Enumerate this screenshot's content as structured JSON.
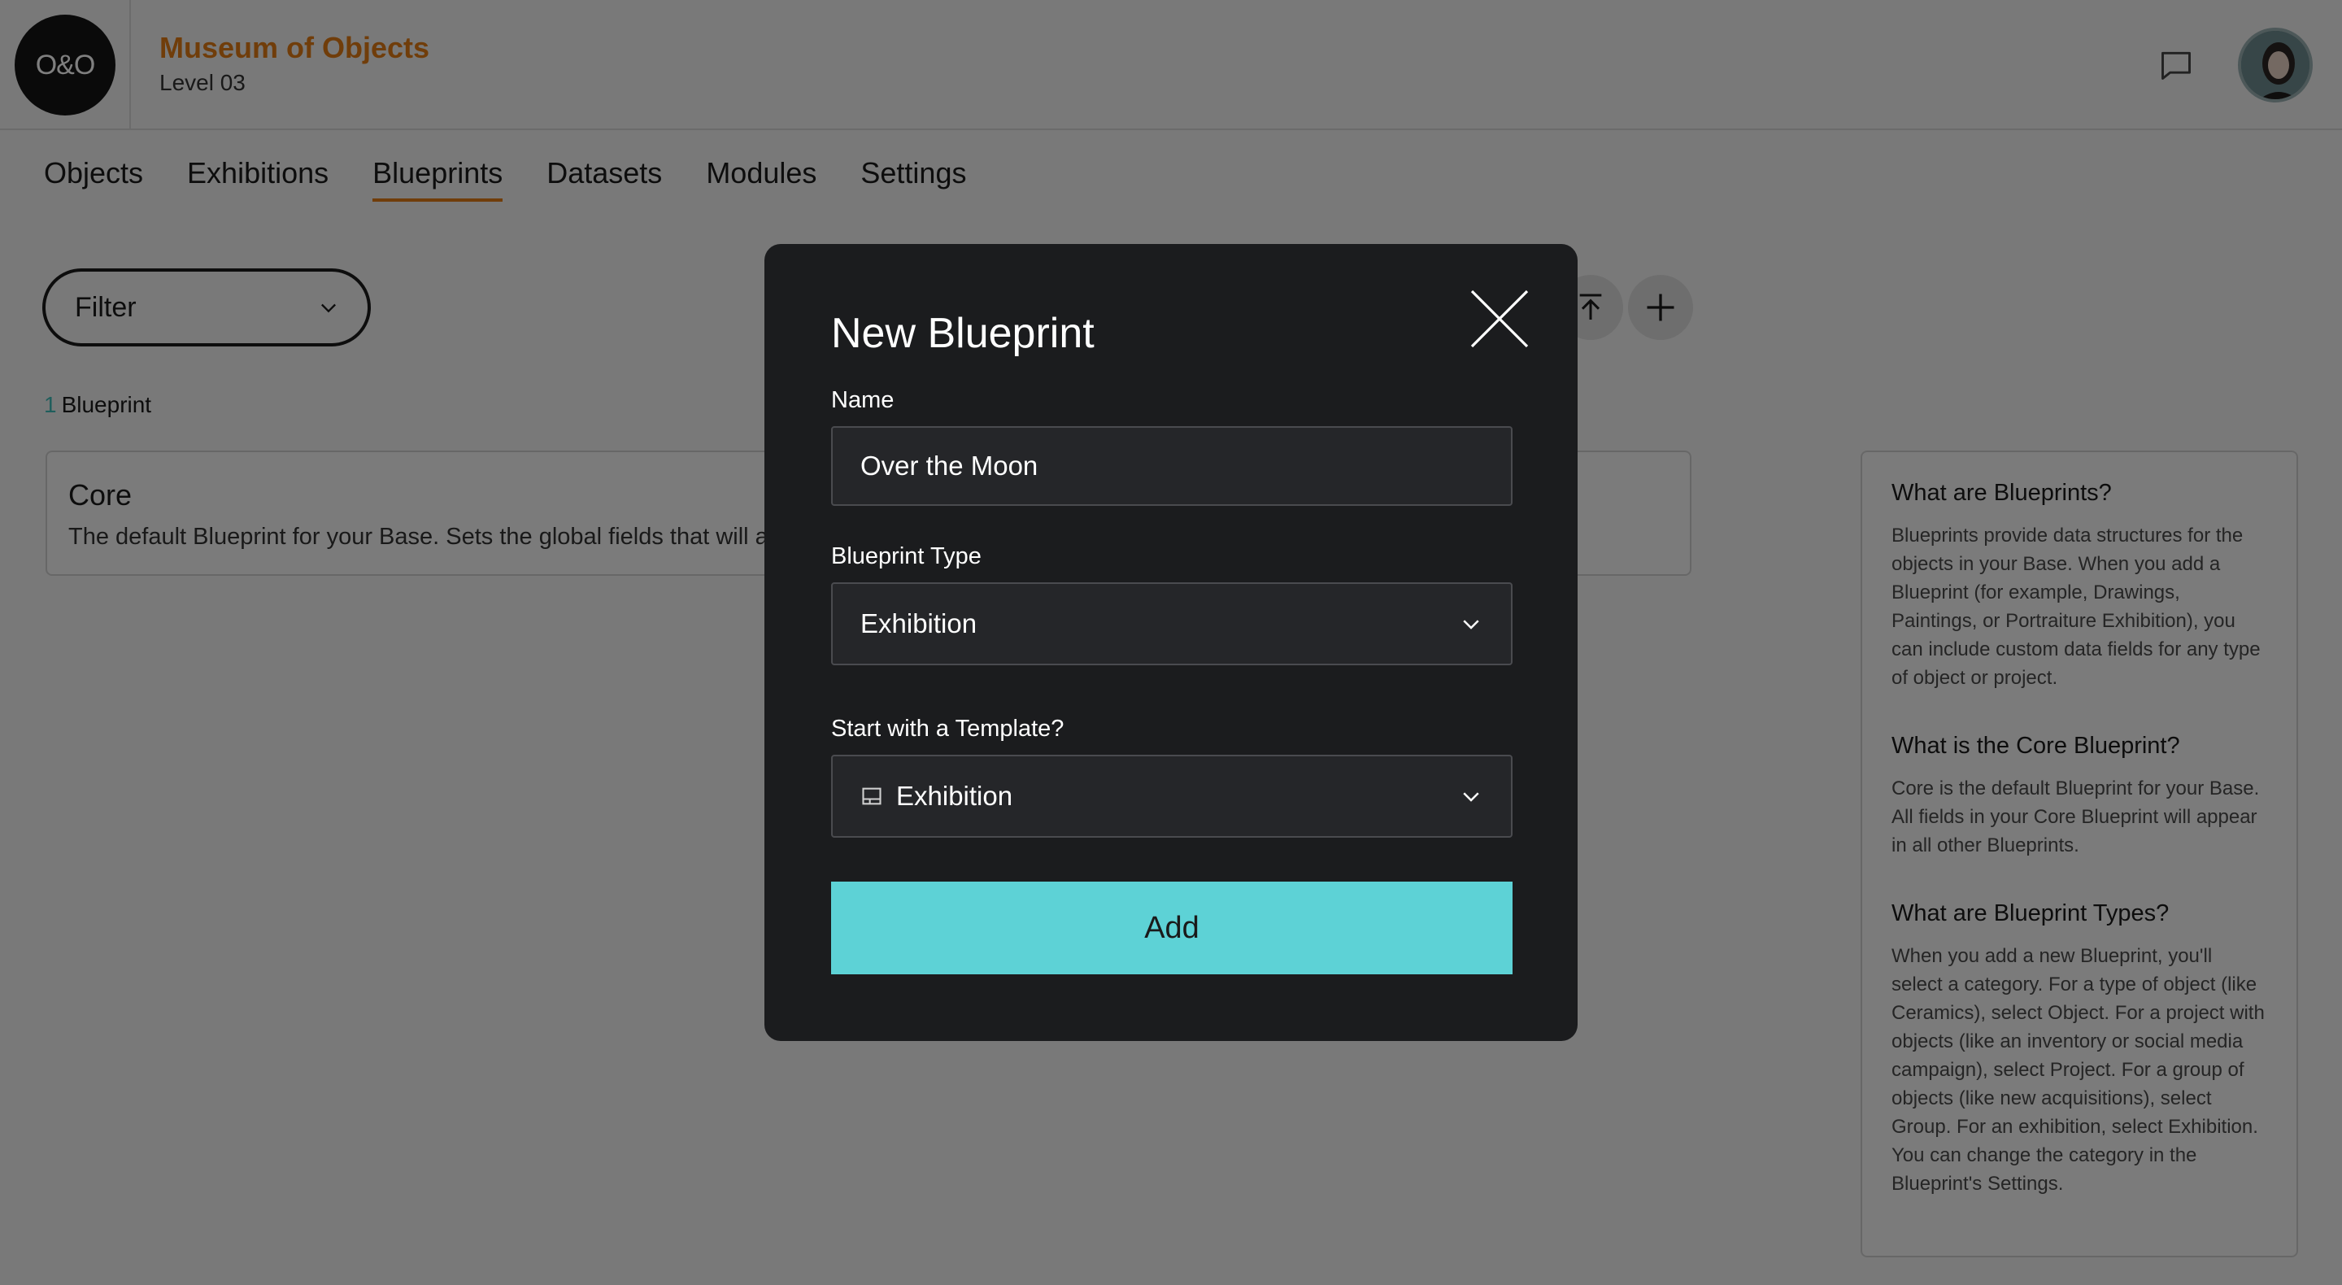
{
  "header": {
    "logo_text": "O&O",
    "org_name": "Museum of Objects",
    "org_level": "Level 03",
    "accent_color": "#e07a14"
  },
  "tabs": [
    {
      "label": "Objects",
      "active": false
    },
    {
      "label": "Exhibitions",
      "active": false
    },
    {
      "label": "Blueprints",
      "active": true
    },
    {
      "label": "Datasets",
      "active": false
    },
    {
      "label": "Modules",
      "active": false
    },
    {
      "label": "Settings",
      "active": false
    }
  ],
  "toolbar": {
    "filter_label": "Filter",
    "count_number": "1",
    "count_label": "Blueprint"
  },
  "core_card": {
    "title": "Core",
    "description": "The default Blueprint for your Base. Sets the global fields that will appear in all other Blueprints."
  },
  "help": {
    "sections": [
      {
        "title": "What are Blueprints?",
        "body": "Blueprints provide data structures for the objects in your Base. When you add a Blueprint (for example, Drawings, Paintings, or Portraiture Exhibition), you can include custom data fields for any type of object or project."
      },
      {
        "title": "What is the Core Blueprint?",
        "body": "Core is the default Blueprint for your Base. All fields in your Core Blueprint will appear in all other Blueprints."
      },
      {
        "title": "What are Blueprint Types?",
        "body": "When you add a new Blueprint, you'll select a category. For a type of object (like Ceramics), select Object. For a project with objects (like an inventory or social media campaign), select Project. For a group of objects (like new acquisitions), select Group. For an exhibition, select Exhibition. You can change the category in the Blueprint's Settings."
      }
    ]
  },
  "modal": {
    "title": "New Blueprint",
    "name_label": "Name",
    "name_value": "Over the Moon",
    "type_label": "Blueprint Type",
    "type_value": "Exhibition",
    "template_label": "Start with a Template?",
    "template_value": "Exhibition",
    "template_icon": "layout-icon",
    "add_label": "Add",
    "add_color": "#5dd2d6"
  }
}
